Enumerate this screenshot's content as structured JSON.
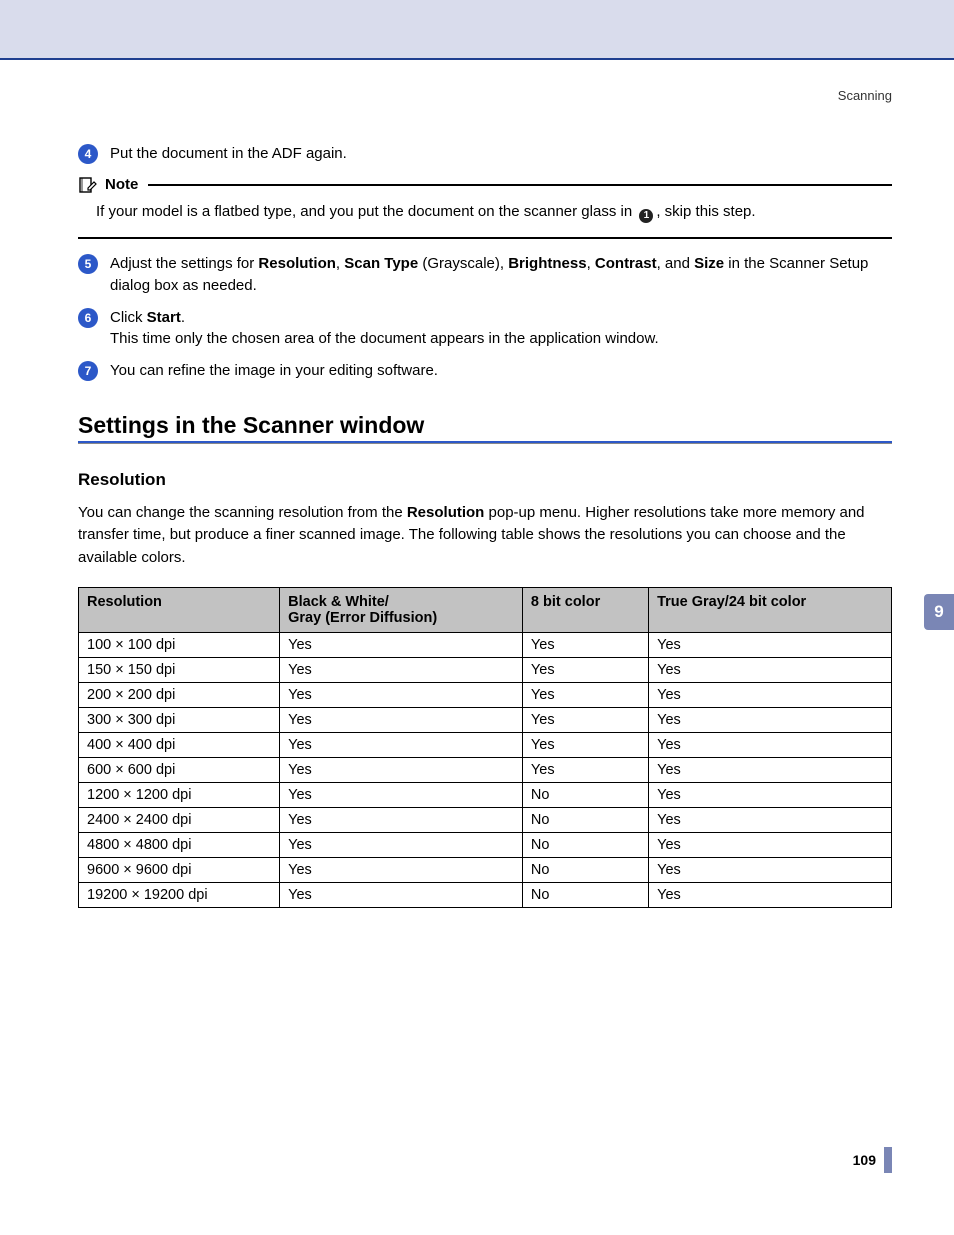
{
  "header": {
    "section_label": "Scanning"
  },
  "chapter_tab": "9",
  "page_number": "109",
  "steps": {
    "s4": {
      "num": "4",
      "text": "Put the document in the ADF again."
    },
    "s5": {
      "num": "5",
      "pre": "Adjust the settings for ",
      "b1": "Resolution",
      "sep1": ", ",
      "b2": "Scan Type",
      "gray": " (Grayscale), ",
      "b3": "Brightness",
      "sep2": ", ",
      "b4": "Contrast",
      "sep3": ", and ",
      "b5": "Size",
      "post": " in the Scanner Setup dialog box as needed."
    },
    "s6": {
      "num": "6",
      "pre": "Click ",
      "b1": "Start",
      "post1": ".",
      "line2": "This time only the chosen area of the document appears in the application window."
    },
    "s7": {
      "num": "7",
      "text": "You can refine the image in your editing software."
    }
  },
  "note": {
    "label": "Note",
    "body_pre": "If your model is a flatbed type, and you put the document on the scanner glass in ",
    "ref": "1",
    "body_post": ", skip this step."
  },
  "section": {
    "title": "Settings in the Scanner window"
  },
  "subsection": {
    "title": "Resolution",
    "para_pre": "You can change the scanning resolution from the ",
    "para_b": "Resolution",
    "para_post": " pop-up menu. Higher resolutions take more memory and transfer time, but produce a finer scanned image. The following table shows the resolutions you can choose and the available colors."
  },
  "table": {
    "headers": {
      "c1": "Resolution",
      "c2a": "Black & White/",
      "c2b": "Gray (Error Diffusion)",
      "c3": "8 bit color",
      "c4": "True Gray/24 bit color"
    },
    "rows": [
      {
        "res": "100 × 100 dpi",
        "bw": "Yes",
        "c8": "Yes",
        "c24": "Yes"
      },
      {
        "res": "150 × 150 dpi",
        "bw": "Yes",
        "c8": "Yes",
        "c24": "Yes"
      },
      {
        "res": "200 × 200 dpi",
        "bw": "Yes",
        "c8": "Yes",
        "c24": "Yes"
      },
      {
        "res": "300 × 300 dpi",
        "bw": "Yes",
        "c8": "Yes",
        "c24": "Yes"
      },
      {
        "res": "400 × 400 dpi",
        "bw": "Yes",
        "c8": "Yes",
        "c24": "Yes"
      },
      {
        "res": "600 × 600 dpi",
        "bw": "Yes",
        "c8": "Yes",
        "c24": "Yes"
      },
      {
        "res": "1200 × 1200 dpi",
        "bw": "Yes",
        "c8": "No",
        "c24": "Yes"
      },
      {
        "res": "2400 × 2400 dpi",
        "bw": "Yes",
        "c8": "No",
        "c24": "Yes"
      },
      {
        "res": "4800 × 4800 dpi",
        "bw": "Yes",
        "c8": "No",
        "c24": "Yes"
      },
      {
        "res": "9600 × 9600 dpi",
        "bw": "Yes",
        "c8": "No",
        "c24": "Yes"
      },
      {
        "res": "19200 × 19200 dpi",
        "bw": "Yes",
        "c8": "No",
        "c24": "Yes"
      }
    ]
  },
  "chart_data": {
    "type": "table",
    "title": "Scanning resolution vs. available color modes",
    "columns": [
      "Resolution",
      "Black & White / Gray (Error Diffusion)",
      "8 bit color",
      "True Gray / 24 bit color"
    ],
    "rows": [
      [
        "100 × 100 dpi",
        "Yes",
        "Yes",
        "Yes"
      ],
      [
        "150 × 150 dpi",
        "Yes",
        "Yes",
        "Yes"
      ],
      [
        "200 × 200 dpi",
        "Yes",
        "Yes",
        "Yes"
      ],
      [
        "300 × 300 dpi",
        "Yes",
        "Yes",
        "Yes"
      ],
      [
        "400 × 400 dpi",
        "Yes",
        "Yes",
        "Yes"
      ],
      [
        "600 × 600 dpi",
        "Yes",
        "Yes",
        "Yes"
      ],
      [
        "1200 × 1200 dpi",
        "Yes",
        "No",
        "Yes"
      ],
      [
        "2400 × 2400 dpi",
        "Yes",
        "No",
        "Yes"
      ],
      [
        "4800 × 4800 dpi",
        "Yes",
        "No",
        "Yes"
      ],
      [
        "9600 × 9600 dpi",
        "Yes",
        "No",
        "Yes"
      ],
      [
        "19200 × 19200 dpi",
        "Yes",
        "No",
        "Yes"
      ]
    ]
  }
}
